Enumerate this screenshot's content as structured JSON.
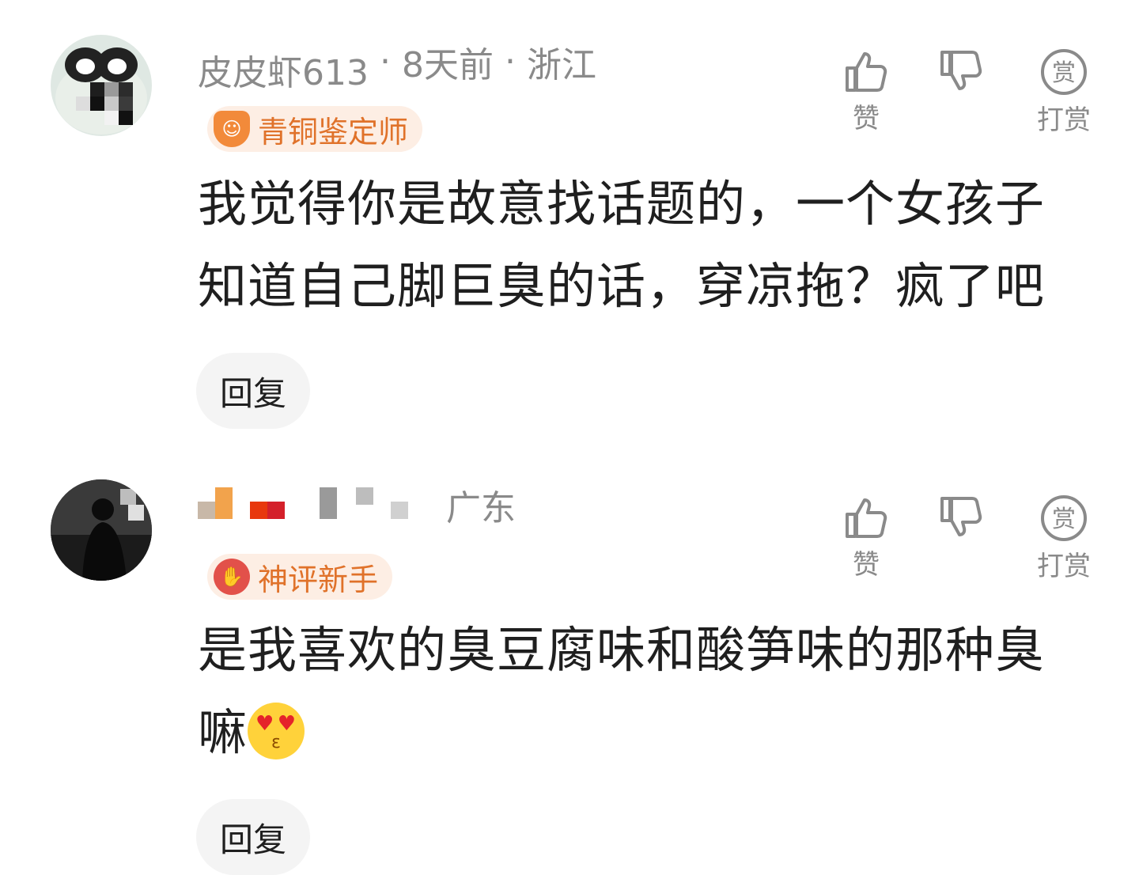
{
  "comments": [
    {
      "username": "皮皮虾613",
      "time": "8天前",
      "location": "浙江",
      "badge": "青铜鉴定师",
      "text": "我觉得你是故意找话题的，一个女孩子知道自己脚巨臭的话，穿凉拖？疯了吧",
      "emoji": "",
      "like_label": "赞",
      "reward_label": "打赏",
      "reply_label": "回复"
    },
    {
      "username": "",
      "time": "",
      "location": "广东",
      "badge": "神评新手",
      "text": "是我喜欢的臭豆腐味和酸笋味的那种臭嘛",
      "emoji": "heart-eyes-kiss-emoji",
      "like_label": "赞",
      "reward_label": "打赏",
      "reply_label": "回复"
    }
  ],
  "colors": {
    "meta_gray": "#8a8a8a",
    "badge_orange": "#e0722a",
    "badge_bg": "#fdeee4",
    "reply_bg": "#f4f4f4"
  }
}
